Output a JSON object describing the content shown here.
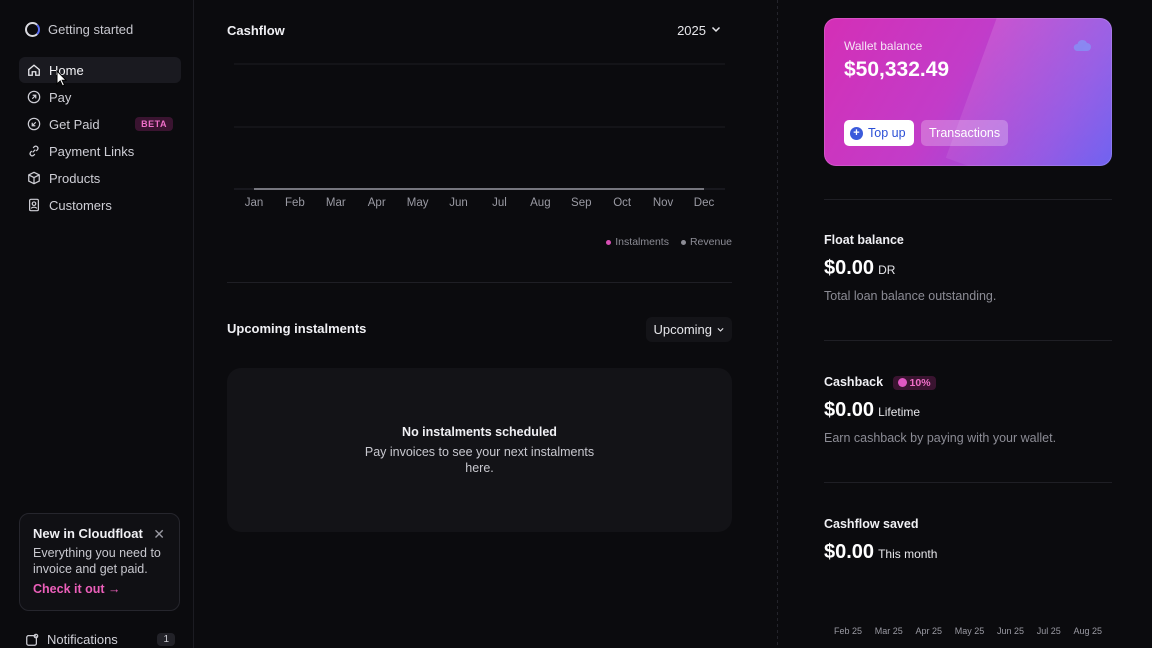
{
  "sidebar": {
    "brand": "Getting started",
    "items": [
      {
        "label": "Home",
        "icon": "home-icon"
      },
      {
        "label": "Pay",
        "icon": "arrow-up-right-circle-icon"
      },
      {
        "label": "Get Paid",
        "icon": "arrow-down-left-circle-icon",
        "badge": "BETA"
      },
      {
        "label": "Payment Links",
        "icon": "link-icon"
      },
      {
        "label": "Products",
        "icon": "box-icon"
      },
      {
        "label": "Customers",
        "icon": "contacts-icon"
      }
    ],
    "promo": {
      "title": "New in Cloudfloat",
      "text": "Everything you need to invoice and get paid.",
      "link": "Check it out →"
    },
    "notifications": {
      "label": "Notifications",
      "count": "1"
    }
  },
  "cashflow": {
    "title": "Cashflow",
    "year": "2025",
    "months": [
      "Jan",
      "Feb",
      "Mar",
      "Apr",
      "May",
      "Jun",
      "Jul",
      "Aug",
      "Sep",
      "Oct",
      "Nov",
      "Dec"
    ],
    "legend": [
      "Instalments",
      "Revenue"
    ],
    "colors": {
      "instalments": "#d84fb4",
      "revenue": "#8c8c95"
    }
  },
  "upcoming": {
    "title": "Upcoming instalments",
    "filter": "Upcoming",
    "empty_title": "No instalments scheduled",
    "empty_text": "Pay invoices to see your next instalments here."
  },
  "wallet": {
    "label": "Wallet balance",
    "amount": "$50,332.49",
    "topup": "Top up",
    "transactions": "Transactions"
  },
  "float_balance": {
    "title": "Float balance",
    "amount": "$0.00",
    "suffix": "DR",
    "desc": "Total loan balance outstanding."
  },
  "cashback": {
    "title": "Cashback",
    "badge": "10%",
    "amount": "$0.00",
    "suffix": "Lifetime",
    "desc": "Earn cashback by paying with your wallet."
  },
  "cashflow_saved": {
    "title": "Cashflow saved",
    "amount": "$0.00",
    "suffix": "This month",
    "months": [
      "Feb 25",
      "Mar 25",
      "Apr 25",
      "May 25",
      "Jun 25",
      "Jul 25",
      "Aug 25"
    ]
  }
}
